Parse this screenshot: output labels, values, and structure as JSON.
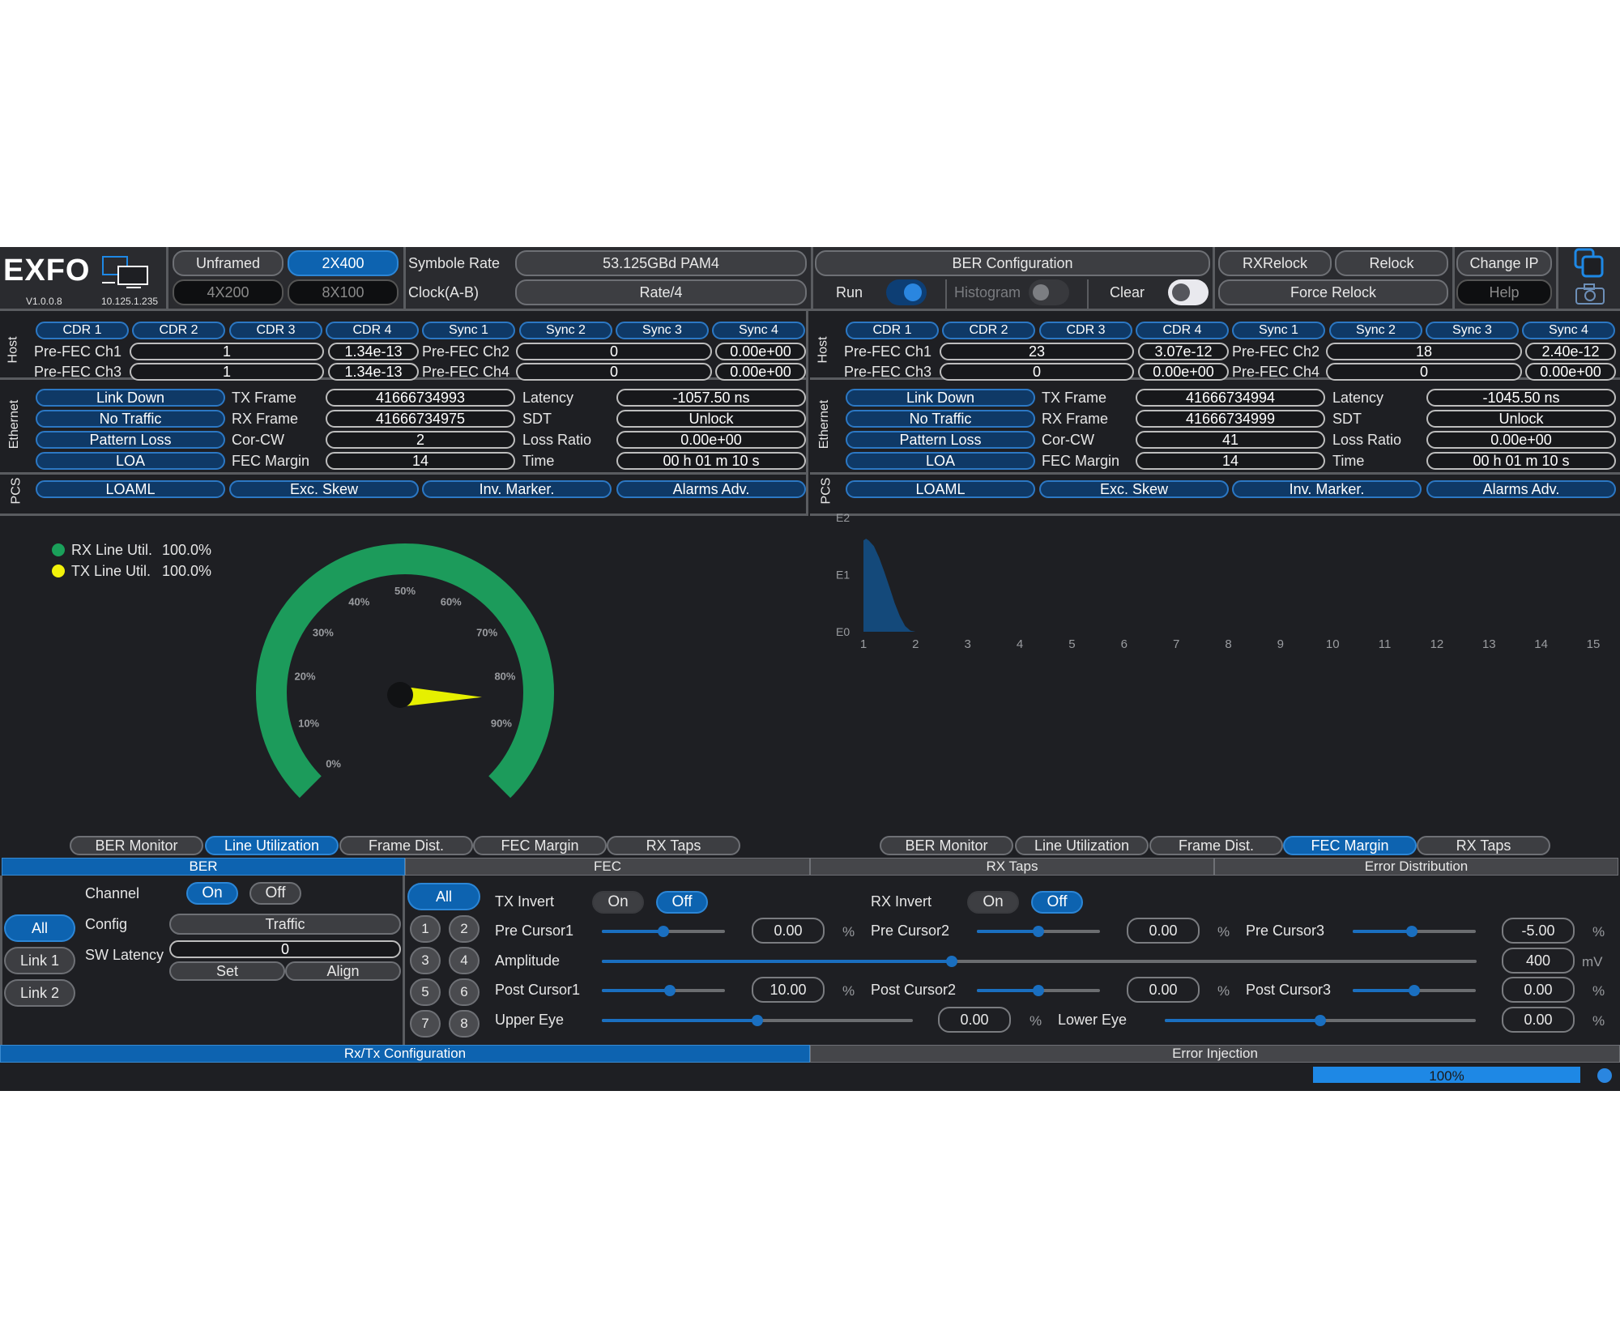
{
  "brand": {
    "logo": "EXFO",
    "version": "V1.0.0.8",
    "ip": "10.125.1.235"
  },
  "modes": {
    "unframed": "Unframed",
    "m2x400": "2X400",
    "m4x200": "4X200",
    "m8x100": "8X100"
  },
  "symbol": {
    "rate_label": "Symbole Rate",
    "rate_value": "53.125GBd PAM4",
    "clock_label": "Clock(A-B)",
    "clock_value": "Rate/4"
  },
  "ber_config": {
    "title": "BER Configuration",
    "run": "Run",
    "histogram": "Histogram",
    "clear": "Clear"
  },
  "actions": {
    "rxrelock": "RXRelock",
    "relock": "Relock",
    "force_relock": "Force Relock",
    "change_ip": "Change IP",
    "help": "Help"
  },
  "side_labels": {
    "host": "Host",
    "ethernet": "Ethernet",
    "pcs": "PCS"
  },
  "host_buttons": [
    "CDR 1",
    "CDR 2",
    "CDR 3",
    "CDR 4",
    "Sync 1",
    "Sync 2",
    "Sync 3",
    "Sync 4"
  ],
  "prefec_labels": {
    "ch1": "Pre-FEC Ch1",
    "ch2": "Pre-FEC Ch2",
    "ch3": "Pre-FEC Ch3",
    "ch4": "Pre-FEC Ch4"
  },
  "eth_alarms": [
    "Link Down",
    "No Traffic",
    "Pattern Loss",
    "LOA"
  ],
  "eth_labels1": [
    "TX Frame",
    "RX Frame",
    "Cor-CW",
    "FEC Margin"
  ],
  "eth_labels2": [
    "Latency",
    "SDT",
    "Loss Ratio",
    "Time"
  ],
  "pcs_buttons": [
    "LOAML",
    "Exc. Skew",
    "Inv. Marker.",
    "Alarms Adv."
  ],
  "left": {
    "prefec": {
      "ch1_count": "1",
      "ch1_ratio": "1.34e-13",
      "ch2_count": "0",
      "ch2_ratio": "0.00e+00",
      "ch3_count": "1",
      "ch3_ratio": "1.34e-13",
      "ch4_count": "0",
      "ch4_ratio": "0.00e+00"
    },
    "eth_values1": [
      "41666734993",
      "41666734975",
      "2",
      "14"
    ],
    "eth_values2": [
      "-1057.50 ns",
      "Unlock",
      "0.00e+00",
      "00 h 01 m 10 s"
    ]
  },
  "right": {
    "prefec": {
      "ch1_count": "23",
      "ch1_ratio": "3.07e-12",
      "ch2_count": "18",
      "ch2_ratio": "2.40e-12",
      "ch3_count": "0",
      "ch3_ratio": "0.00e+00",
      "ch4_count": "0",
      "ch4_ratio": "0.00e+00"
    },
    "eth_values1": [
      "41666734994",
      "41666734999",
      "41",
      "14"
    ],
    "eth_values2": [
      "-1045.50 ns",
      "Unlock",
      "0.00e+00",
      "00 h 01 m 10 s"
    ]
  },
  "gauge": {
    "legend": [
      {
        "label": "RX Line Util.",
        "value": "100.0%",
        "color": "#1aa05a"
      },
      {
        "label": "TX Line Util.",
        "value": "100.0%",
        "color": "#f2f20a"
      }
    ],
    "ticks": [
      "0%",
      "10%",
      "20%",
      "30%",
      "40%",
      "50%",
      "60%",
      "70%",
      "80%",
      "90%"
    ],
    "arc_color": "#1c9b5b",
    "needle_color": "#e6f000",
    "needle_value": 0.835
  },
  "chart_data": {
    "type": "area",
    "x_ticks": [
      "1",
      "2",
      "3",
      "4",
      "5",
      "6",
      "7",
      "8",
      "9",
      "10",
      "11",
      "12",
      "13",
      "14",
      "15"
    ],
    "y_ticks": [
      "E0",
      "E1",
      "E2"
    ],
    "xlim": [
      1,
      15
    ],
    "ylim": [
      0,
      2
    ],
    "x": [
      1.0,
      1.05,
      1.1,
      1.2,
      1.3,
      1.4,
      1.5,
      1.6,
      1.7,
      1.8,
      1.9,
      2.0
    ],
    "y": [
      1.6,
      1.63,
      1.6,
      1.5,
      1.3,
      1.05,
      0.78,
      0.5,
      0.27,
      0.1,
      0.02,
      0.0
    ],
    "color": "#14497a"
  },
  "view_tabs": [
    "BER Monitor",
    "Line Utilization",
    "Frame Dist.",
    "FEC Margin",
    "RX Taps"
  ],
  "section_tabs": {
    "ber": "BER",
    "fec": "FEC",
    "rx_taps": "RX Taps",
    "error_dist": "Error Distribution"
  },
  "ber_panel": {
    "channel": "Channel",
    "on": "On",
    "off": "Off",
    "config": "Config",
    "config_value": "Traffic",
    "sw_latency": "SW Latency",
    "sw_latency_value": "0",
    "set": "Set",
    "align": "Align",
    "links": [
      "All",
      "Link 1",
      "Link 2"
    ]
  },
  "lane_buttons": {
    "all": "All",
    "nums": [
      "1",
      "2",
      "3",
      "4",
      "5",
      "6",
      "7",
      "8"
    ]
  },
  "taps": {
    "tx_invert": "TX Invert",
    "rx_invert": "RX Invert",
    "on": "On",
    "off": "Off",
    "pre_cursor1": "Pre Cursor1",
    "pre_cursor1_value": "0.00",
    "pre_cursor1_level": 0.5,
    "pre_cursor2": "Pre Cursor2",
    "pre_cursor2_value": "0.00",
    "pre_cursor2_level": 0.5,
    "pre_cursor3": "Pre Cursor3",
    "pre_cursor3_value": "-5.00",
    "pre_cursor3_level": 0.48,
    "amplitude": "Amplitude",
    "amplitude_value": "400",
    "amplitude_level": 0.4,
    "post_cursor1": "Post Cursor1",
    "post_cursor1_value": "10.00",
    "post_cursor1_level": 0.55,
    "post_cursor2": "Post Cursor2",
    "post_cursor2_value": "0.00",
    "post_cursor2_level": 0.5,
    "post_cursor3": "Post Cursor3",
    "post_cursor3_value": "0.00",
    "post_cursor3_level": 0.5,
    "upper_eye": "Upper Eye",
    "upper_eye_value": "0.00",
    "upper_eye_level": 0.5,
    "lower_eye": "Lower Eye",
    "lower_eye_value": "0.00",
    "lower_eye_level": 0.5,
    "percent": "%",
    "mv": "mV"
  },
  "bottom_tabs": {
    "rxtx": "Rx/Tx Configuration",
    "error_injection": "Error Injection"
  },
  "status": {
    "progress_text": "100%",
    "progress": 1.0
  },
  "icons": {
    "network": "network-icon",
    "copy": "copy-windows-icon",
    "camera": "camera-icon"
  }
}
